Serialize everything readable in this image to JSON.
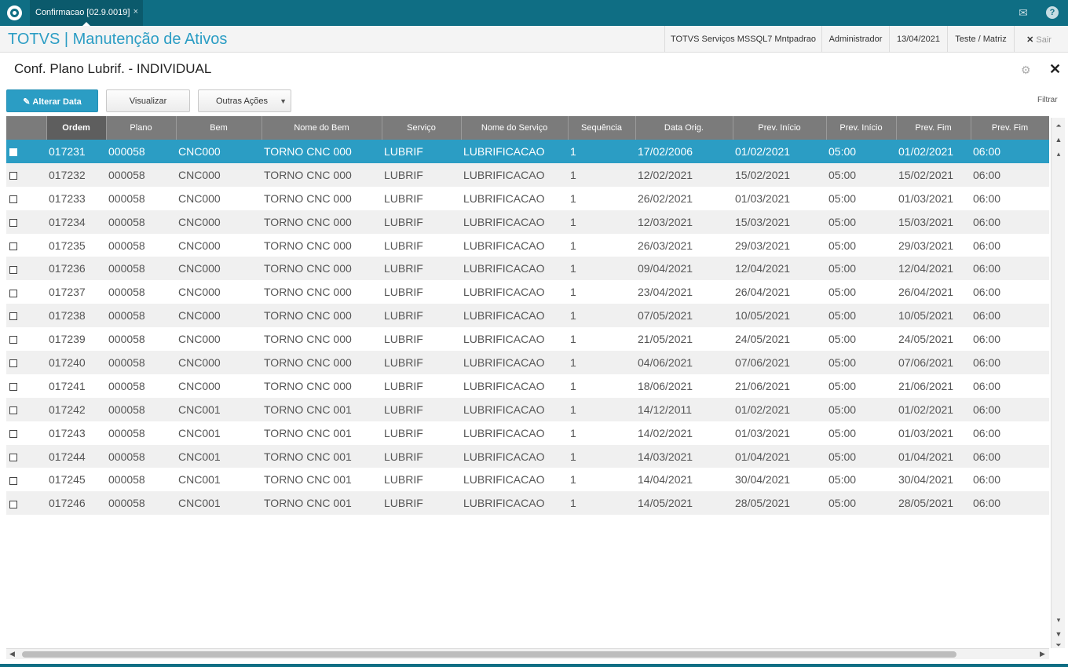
{
  "app": {
    "tab_label": "Confirmacao [02.9.0019]",
    "tab_close": "×",
    "title": "TOTVS | Manutenção de Ativos"
  },
  "header": {
    "environment": "TOTVS Serviços MSSQL7 Mntpadrao",
    "user": "Administrador",
    "date": "13/04/2021",
    "company": "Teste / Matriz",
    "logout": "Sair"
  },
  "window": {
    "title": "Conf. Plano Lubrif. - INDIVIDUAL"
  },
  "toolbar": {
    "alterar_label": "Alterar Data",
    "visualizar_label": "Visualizar",
    "outras_label": "Outras Ações",
    "filtrar_label": "Filtrar"
  },
  "colors": {
    "accent": "#2b9dc4",
    "topbar": "#0f6e84",
    "header_bg": "#7b7b7b"
  },
  "grid": {
    "columns": [
      "",
      "Ordem",
      "Plano",
      "Bem",
      "Nome do Bem",
      "Serviço",
      "Nome do Serviço",
      "Sequência",
      "Data Orig.",
      "Prev. Início",
      "Prev. Início",
      "Prev. Fim",
      "Prev. Fim"
    ],
    "rows": [
      [
        "017231",
        "000058",
        "CNC000",
        "TORNO CNC 000",
        "LUBRIF",
        "LUBRIFICACAO",
        "1",
        "17/02/2006",
        "01/02/2021",
        "05:00",
        "01/02/2021",
        "06:00"
      ],
      [
        "017232",
        "000058",
        "CNC000",
        "TORNO CNC 000",
        "LUBRIF",
        "LUBRIFICACAO",
        "1",
        "12/02/2021",
        "15/02/2021",
        "05:00",
        "15/02/2021",
        "06:00"
      ],
      [
        "017233",
        "000058",
        "CNC000",
        "TORNO CNC 000",
        "LUBRIF",
        "LUBRIFICACAO",
        "1",
        "26/02/2021",
        "01/03/2021",
        "05:00",
        "01/03/2021",
        "06:00"
      ],
      [
        "017234",
        "000058",
        "CNC000",
        "TORNO CNC 000",
        "LUBRIF",
        "LUBRIFICACAO",
        "1",
        "12/03/2021",
        "15/03/2021",
        "05:00",
        "15/03/2021",
        "06:00"
      ],
      [
        "017235",
        "000058",
        "CNC000",
        "TORNO CNC 000",
        "LUBRIF",
        "LUBRIFICACAO",
        "1",
        "26/03/2021",
        "29/03/2021",
        "05:00",
        "29/03/2021",
        "06:00"
      ],
      [
        "017236",
        "000058",
        "CNC000",
        "TORNO CNC 000",
        "LUBRIF",
        "LUBRIFICACAO",
        "1",
        "09/04/2021",
        "12/04/2021",
        "05:00",
        "12/04/2021",
        "06:00"
      ],
      [
        "017237",
        "000058",
        "CNC000",
        "TORNO CNC 000",
        "LUBRIF",
        "LUBRIFICACAO",
        "1",
        "23/04/2021",
        "26/04/2021",
        "05:00",
        "26/04/2021",
        "06:00"
      ],
      [
        "017238",
        "000058",
        "CNC000",
        "TORNO CNC 000",
        "LUBRIF",
        "LUBRIFICACAO",
        "1",
        "07/05/2021",
        "10/05/2021",
        "05:00",
        "10/05/2021",
        "06:00"
      ],
      [
        "017239",
        "000058",
        "CNC000",
        "TORNO CNC 000",
        "LUBRIF",
        "LUBRIFICACAO",
        "1",
        "21/05/2021",
        "24/05/2021",
        "05:00",
        "24/05/2021",
        "06:00"
      ],
      [
        "017240",
        "000058",
        "CNC000",
        "TORNO CNC 000",
        "LUBRIF",
        "LUBRIFICACAO",
        "1",
        "04/06/2021",
        "07/06/2021",
        "05:00",
        "07/06/2021",
        "06:00"
      ],
      [
        "017241",
        "000058",
        "CNC000",
        "TORNO CNC 000",
        "LUBRIF",
        "LUBRIFICACAO",
        "1",
        "18/06/2021",
        "21/06/2021",
        "05:00",
        "21/06/2021",
        "06:00"
      ],
      [
        "017242",
        "000058",
        "CNC001",
        "TORNO CNC 001",
        "LUBRIF",
        "LUBRIFICACAO",
        "1",
        "14/12/2011",
        "01/02/2021",
        "05:00",
        "01/02/2021",
        "06:00"
      ],
      [
        "017243",
        "000058",
        "CNC001",
        "TORNO CNC 001",
        "LUBRIF",
        "LUBRIFICACAO",
        "1",
        "14/02/2021",
        "01/03/2021",
        "05:00",
        "01/03/2021",
        "06:00"
      ],
      [
        "017244",
        "000058",
        "CNC001",
        "TORNO CNC 001",
        "LUBRIF",
        "LUBRIFICACAO",
        "1",
        "14/03/2021",
        "01/04/2021",
        "05:00",
        "01/04/2021",
        "06:00"
      ],
      [
        "017245",
        "000058",
        "CNC001",
        "TORNO CNC 001",
        "LUBRIF",
        "LUBRIFICACAO",
        "1",
        "14/04/2021",
        "30/04/2021",
        "05:00",
        "30/04/2021",
        "06:00"
      ],
      [
        "017246",
        "000058",
        "CNC001",
        "TORNO CNC 001",
        "LUBRIF",
        "LUBRIFICACAO",
        "1",
        "14/05/2021",
        "28/05/2021",
        "05:00",
        "28/05/2021",
        "06:00"
      ]
    ]
  }
}
